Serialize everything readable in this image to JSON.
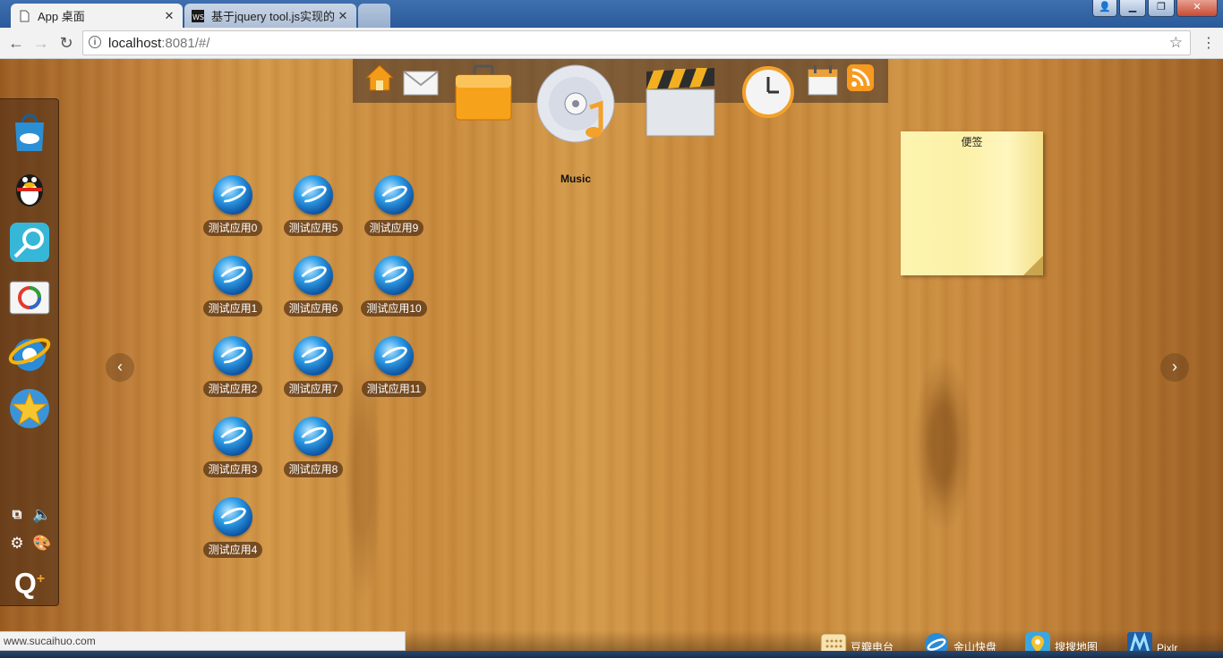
{
  "browser": {
    "tabs": [
      {
        "title": "App 桌面",
        "active": true
      },
      {
        "title": "基于jquery tool.js实现的",
        "active": false
      }
    ],
    "url_host": "localhost",
    "url_rest": ":8081/#/"
  },
  "top_dock": {
    "items": [
      "home-icon",
      "mail-icon",
      "briefcase-icon",
      "music-disc-icon",
      "clapperboard-icon",
      "clock-icon",
      "calendar-icon",
      "rss-icon"
    ],
    "active_label": "Music"
  },
  "left_dock": {
    "items": [
      "app-store-icon",
      "qq-penguin-icon",
      "search-map-icon",
      "photo-viewer-icon",
      "ie-browser-icon",
      "qzone-star-icon"
    ]
  },
  "apps": [
    {
      "label": "测试应用0"
    },
    {
      "label": "测试应用1"
    },
    {
      "label": "测试应用2"
    },
    {
      "label": "测试应用3"
    },
    {
      "label": "测试应用4"
    },
    {
      "label": "测试应用5"
    },
    {
      "label": "测试应用6"
    },
    {
      "label": "测试应用7"
    },
    {
      "label": "测试应用8"
    },
    {
      "label": "测试应用9"
    },
    {
      "label": "测试应用10"
    },
    {
      "label": "测试应用11"
    }
  ],
  "sticky_note": {
    "title": "便签"
  },
  "taskbar": [
    {
      "label": "豆瓣电台",
      "icon": "radio-icon"
    },
    {
      "label": "金山快盘",
      "icon": "cloud-disk-icon"
    },
    {
      "label": "搜搜地图",
      "icon": "map-icon"
    },
    {
      "label": "Pixlr",
      "icon": "pixlr-icon"
    }
  ],
  "status_url": "www.sucaihuo.com"
}
